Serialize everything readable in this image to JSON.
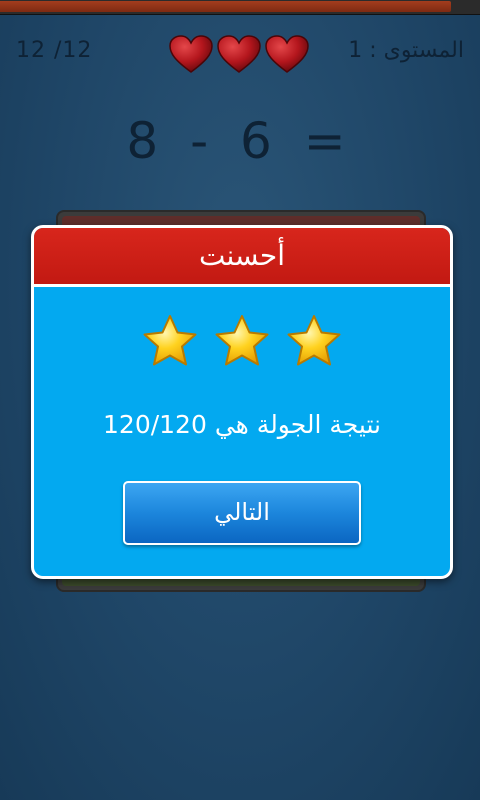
{
  "hud": {
    "progress_fraction": 0.94,
    "counter": "12 /12",
    "level_label": "المستوى : 1",
    "hearts": 3
  },
  "equation": "8 - 6 =",
  "dialog": {
    "title": "أحسنت",
    "stars": 3,
    "score_text": "نتيجة الجولة هي 120/120",
    "next_label": "التالي"
  },
  "colors": {
    "dialog_header": "#c8201a",
    "dialog_body": "#03a9f0",
    "button": "#1c86dc",
    "heart": "#b4161d",
    "star": "#ffd21f"
  },
  "icons": {
    "heart": "heart-icon",
    "star": "star-icon"
  }
}
